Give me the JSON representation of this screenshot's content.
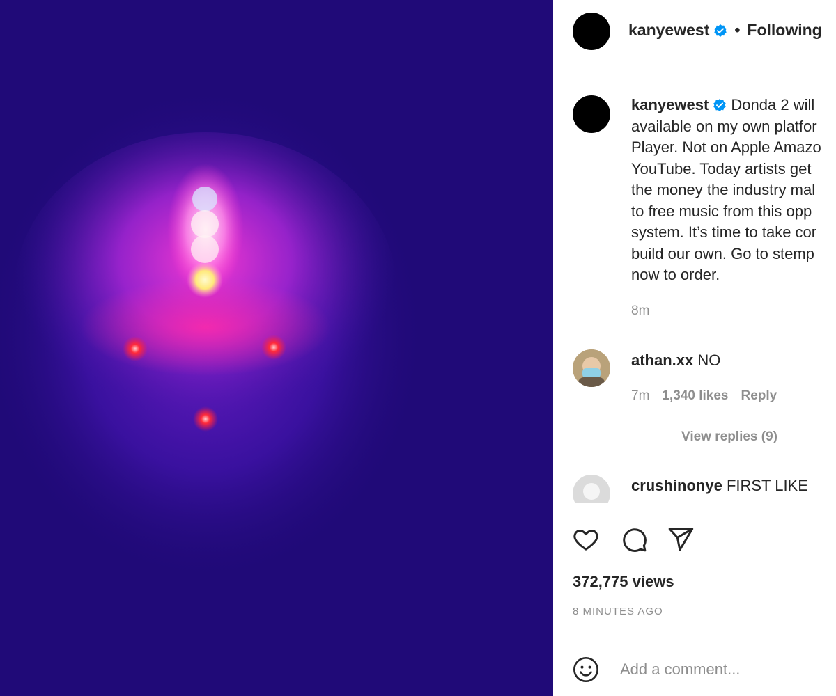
{
  "colors": {
    "media_background": "#200a78",
    "verified_blue": "#0095f6",
    "muted_text": "#8e8e8e",
    "primary_text": "#262626"
  },
  "header": {
    "username": "kanyewest",
    "verified_icon": "verified-badge-icon",
    "separator": "•",
    "follow_status": "Following"
  },
  "caption": {
    "username": "kanyewest",
    "text": "Donda 2 will\navailable on my own platfor\nPlayer. Not on Apple Amazo\nYouTube. Today artists get\nthe money the industry mal\nto free music from this opp\nsystem. It’s time to take cor\nbuild our own. Go to stemp\nnow to order.",
    "time": "8m"
  },
  "comments": [
    {
      "username": "athan.xx",
      "text": "NO",
      "time": "7m",
      "likes": "1,340 likes",
      "reply_label": "Reply",
      "view_replies": "View replies (9)"
    },
    {
      "username": "crushinonye",
      "text": "FIRST LIKE"
    }
  ],
  "actions": {
    "icons": [
      "heart-icon",
      "comment-bubble-icon",
      "share-paper-plane-icon"
    ],
    "views": "372,775 views",
    "time_ago": "8 MINUTES AGO"
  },
  "add_comment": {
    "emoji_icon": "emoji-smile-icon",
    "placeholder": "Add a comment..."
  }
}
